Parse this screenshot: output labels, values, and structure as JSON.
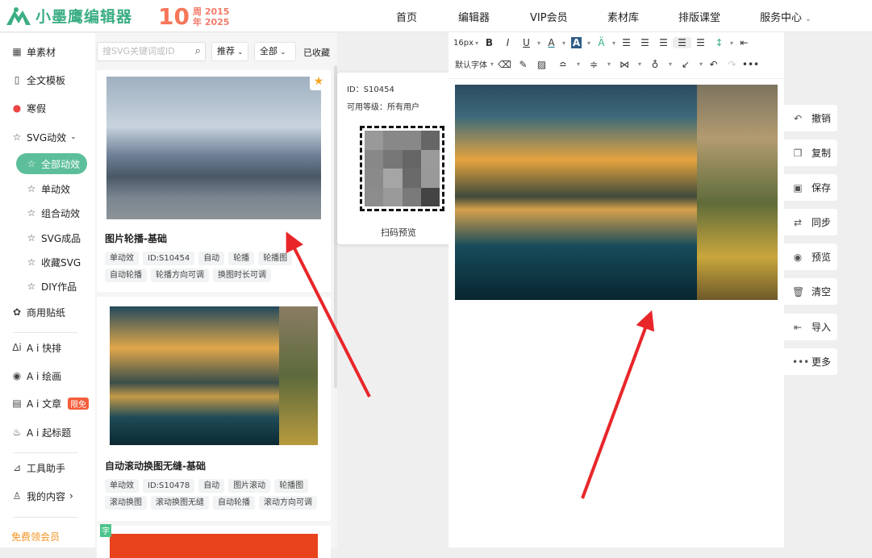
{
  "header": {
    "logo_text": "小墨鹰编辑器",
    "anniversary": {
      "number": "10",
      "char1": "周",
      "char2": "年",
      "year_start": "2015",
      "year_end": "2025"
    },
    "nav": [
      "首页",
      "编辑器",
      "VIP会员",
      "素材库",
      "排版课堂",
      "服务中心"
    ]
  },
  "sidebar": {
    "items": [
      {
        "label": "单素材",
        "icon": "grid-icon"
      },
      {
        "label": "全文模板",
        "icon": "template-icon"
      },
      {
        "label": "寒假",
        "icon": "snowman-icon"
      },
      {
        "label": "SVG动效",
        "icon": "star-s-icon"
      }
    ],
    "sub_items": [
      "全部动效",
      "单动效",
      "组合动效",
      "SVG成品",
      "收藏SVG",
      "DIY作品"
    ],
    "items2": [
      {
        "label": "商用贴纸"
      },
      {
        "label": "A i 快排"
      },
      {
        "label": "A i 绘画"
      },
      {
        "label": "A i 文章",
        "badge": "限免"
      },
      {
        "label": "A i 起标题"
      },
      {
        "label": "工具助手"
      },
      {
        "label": "我的内容"
      }
    ],
    "free_vip": "免费领会员"
  },
  "panel": {
    "search_placeholder": "搜SVG关键词或ID",
    "sort": "推荐",
    "filter": "全部",
    "favorites": "已收藏",
    "cards": [
      {
        "title": "图片轮播-基础",
        "tags": [
          "单动效",
          "ID:S10454",
          "自动",
          "轮播",
          "轮播图",
          "自动轮播",
          "轮播方向可调",
          "换图时长可调"
        ]
      },
      {
        "title": "自动滚动换图无缝-基础",
        "tags": [
          "单动效",
          "ID:S10478",
          "自动",
          "图片滚动",
          "轮播图",
          "滚动换图",
          "滚动换图无缝",
          "自动轮播",
          "滚动方向可调"
        ]
      }
    ],
    "card3_badge": "字"
  },
  "popover": {
    "id_line": "ID：S10454",
    "level_line": "可用等级：所有用户",
    "scan_label": "扫码预览"
  },
  "toolbar": {
    "font_size": "16px",
    "font_family": "默认字体"
  },
  "right_actions": [
    "撤销",
    "复制",
    "保存",
    "同步",
    "预览",
    "清空",
    "导入",
    "更多"
  ],
  "colors": {
    "brand": "#3bae83",
    "active": "#5cbf9a",
    "arrow": "#e8262a",
    "badge": "#f45c3a"
  }
}
